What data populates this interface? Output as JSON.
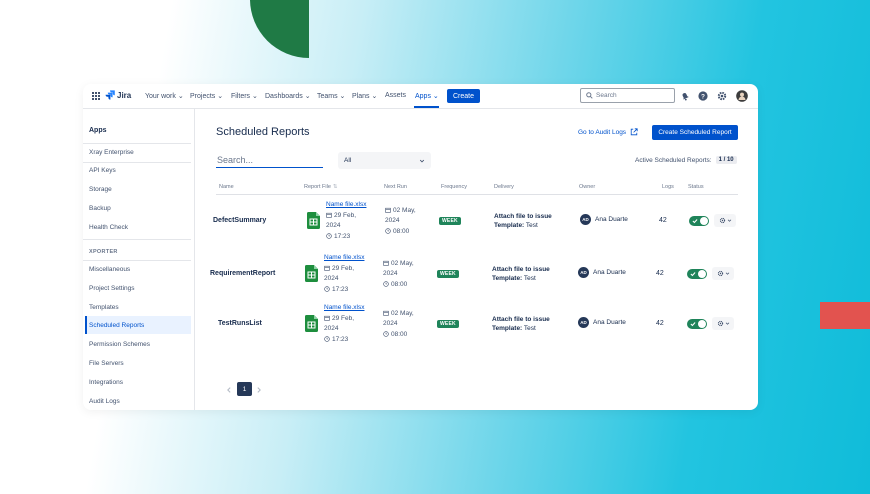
{
  "colors": {
    "accent": "#0052cc",
    "success": "#1f845a",
    "decor_green": "#1f7a45",
    "decor_red": "#e2534f"
  },
  "topnav": {
    "apps_icon": "app-switcher-grid-icon",
    "logo_text": "Jira",
    "items": [
      {
        "label": "Your work ⌄"
      },
      {
        "label": "Projects ⌄"
      },
      {
        "label": "Filters ⌄"
      },
      {
        "label": "Dashboards ⌄"
      },
      {
        "label": "Teams ⌄"
      },
      {
        "label": "Plans ⌄"
      },
      {
        "label": "Assets"
      },
      {
        "label": "Apps ⌄"
      }
    ],
    "create_label": "Create",
    "search_placeholder": "Search",
    "icons": [
      "notifications-icon",
      "help-icon",
      "settings-icon",
      "avatar"
    ]
  },
  "sidebar": {
    "heading": "Apps",
    "group1": [
      "Xray Enterprise",
      "API Keys",
      "Storage",
      "Backup",
      "Health Check"
    ],
    "section_label": "XPORTER",
    "group2": [
      "Miscellaneous",
      "Project Settings",
      "Templates",
      "Scheduled Reports",
      "Permission Schemes",
      "File Servers",
      "Integrations",
      "Audit Logs"
    ],
    "selected": "Scheduled Reports"
  },
  "main": {
    "title": "Scheduled Reports",
    "audit_link": "Go to Audit Logs",
    "create_button": "Create Scheduled Report",
    "search_placeholder": "Search...",
    "filter_value": "All",
    "active_label": "Active Scheduled Reports:",
    "active_count": "1 / 10"
  },
  "table": {
    "headers": [
      "Name",
      "Report File",
      "Next Run",
      "Frequency",
      "Delivery",
      "Owner",
      "Logs",
      "Status"
    ],
    "rows": [
      {
        "name": "DefectSummary",
        "file": "Name file.xlsx",
        "file_date_1": "29 Feb,",
        "file_date_2": "2024",
        "file_time": "17:23",
        "next_1": "02 May,",
        "next_2": "2024",
        "next_time": "08:00",
        "frequency": "WEEK",
        "delivery_1": "Attach file to issue",
        "delivery_2_label": "Template:",
        "delivery_2_value": " Test",
        "owner_initials": "AD",
        "owner": "Ana Duarte",
        "logs": "42"
      },
      {
        "name": "RequirementReport",
        "file": "Name file.xlsx",
        "file_date_1": "29 Feb,",
        "file_date_2": "2024",
        "file_time": "17:23",
        "next_1": "02 May,",
        "next_2": "2024",
        "next_time": "08:00",
        "frequency": "WEEK",
        "delivery_1": "Attach file to issue",
        "delivery_2_label": "Template:",
        "delivery_2_value": " Test",
        "owner_initials": "AD",
        "owner": "Ana Duarte",
        "logs": "42"
      },
      {
        "name": "TestRunsList",
        "file": "Name file.xlsx",
        "file_date_1": "29 Feb,",
        "file_date_2": "2024",
        "file_time": "17:23",
        "next_1": "02 May,",
        "next_2": "2024",
        "next_time": "08:00",
        "frequency": "WEEK",
        "delivery_1": "Attach file to issue",
        "delivery_2_label": "Template:",
        "delivery_2_value": " Test",
        "owner_initials": "AD",
        "owner": "Ana Duarte",
        "logs": "42"
      }
    ]
  },
  "pagination": {
    "current": "1"
  }
}
